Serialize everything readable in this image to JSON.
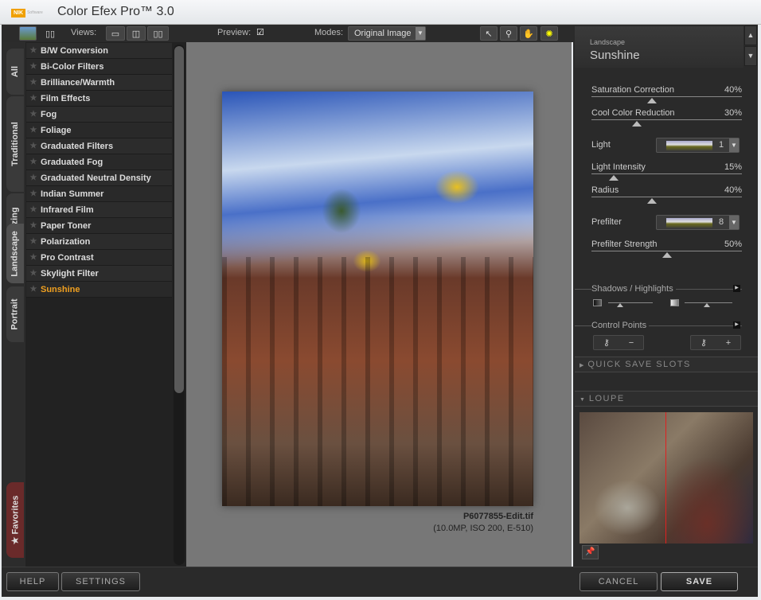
{
  "app": {
    "brand": "NIK Software",
    "title": "Color Efex Pro™ 3.0"
  },
  "toolbar": {
    "views_label": "Views:",
    "preview_label": "Preview:",
    "preview_checked": true,
    "modes_label": "Modes:",
    "mode_value": "Original Image"
  },
  "tabs": [
    "All",
    "Traditional",
    "Stylizing",
    "Landscape",
    "Portrait"
  ],
  "favorites_tab": "Favorites",
  "filters": [
    {
      "label": "B/W Conversion"
    },
    {
      "label": "Bi-Color Filters"
    },
    {
      "label": "Brilliance/Warmth"
    },
    {
      "label": "Film Effects"
    },
    {
      "label": "Fog"
    },
    {
      "label": "Foliage"
    },
    {
      "label": "Graduated Filters"
    },
    {
      "label": "Graduated Fog"
    },
    {
      "label": "Graduated Neutral Density"
    },
    {
      "label": "Indian Summer"
    },
    {
      "label": "Infrared Film"
    },
    {
      "label": "Paper Toner"
    },
    {
      "label": "Polarization"
    },
    {
      "label": "Pro Contrast"
    },
    {
      "label": "Skylight Filter"
    },
    {
      "label": "Sunshine",
      "selected": true
    }
  ],
  "image": {
    "filename": "P6077855-Edit.tif",
    "meta": "(10.0MP, ISO 200, E-510)"
  },
  "filter_panel": {
    "category": "Landscape",
    "name": "Sunshine",
    "saturation": {
      "label": "Saturation Correction",
      "value": "40%",
      "pct": 40
    },
    "cool": {
      "label": "Cool Color Reduction",
      "value": "30%",
      "pct": 30
    },
    "light": {
      "label": "Light",
      "value": "1"
    },
    "intensity": {
      "label": "Light Intensity",
      "value": "15%",
      "pct": 15
    },
    "radius": {
      "label": "Radius",
      "value": "40%",
      "pct": 40
    },
    "prefilter": {
      "label": "Prefilter",
      "value": "8"
    },
    "prefilter_strength": {
      "label": "Prefilter Strength",
      "value": "50%",
      "pct": 50
    },
    "shadows_highlights": "Shadows / Highlights",
    "control_points": "Control Points"
  },
  "panels": {
    "quick_save": "QUICK SAVE SLOTS",
    "loupe": "LOUPE"
  },
  "buttons": {
    "help": "HELP",
    "settings": "SETTINGS",
    "cancel": "CANCEL",
    "save": "SAVE"
  },
  "colors": {
    "accent": "#f0a020",
    "panel": "#2a2a2a"
  }
}
